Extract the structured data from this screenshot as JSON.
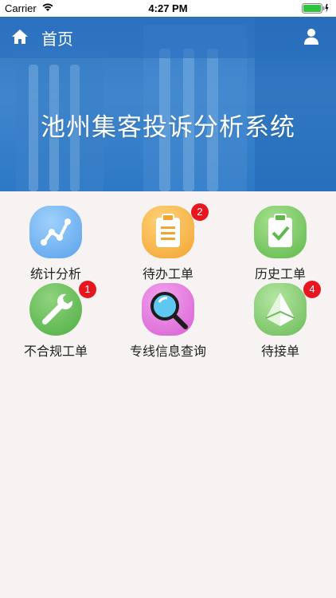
{
  "status_bar": {
    "carrier": "Carrier",
    "time": "4:27 PM"
  },
  "nav": {
    "title": "首页",
    "icons": [
      "home-icon",
      "user-icon"
    ]
  },
  "banner": {
    "title": "池州集客投诉分析系统"
  },
  "menu": [
    {
      "label": "统计分析",
      "icon": "chart-icon",
      "color": "#5fa8ee",
      "badge": ""
    },
    {
      "label": "待办工单",
      "icon": "clipboard-icon",
      "color": "#f5ae3a",
      "badge": "2"
    },
    {
      "label": "历史工单",
      "icon": "clipboard-check-icon",
      "color": "#6cc35c",
      "badge": ""
    },
    {
      "label": "不合规工单",
      "icon": "wrench-icon",
      "color": "#5cb85a",
      "badge": "1"
    },
    {
      "label": "专线信息查询",
      "icon": "magnifier-icon",
      "color": "#de6fd8",
      "badge": ""
    },
    {
      "label": "待接单",
      "icon": "pyramid-icon",
      "color": "#7cc267",
      "badge": "4"
    }
  ]
}
